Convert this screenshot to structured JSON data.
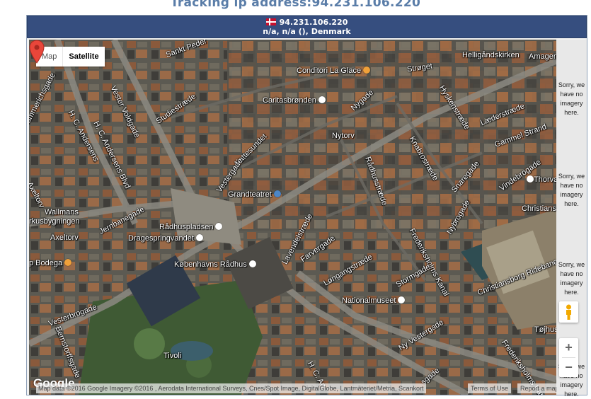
{
  "page": {
    "title": "Tracking ip address:94.231.106.220"
  },
  "header": {
    "ip": "94.231.106.220",
    "location": "n/a, n/a (), Denmark",
    "flag": "denmark-flag-icon"
  },
  "map": {
    "type_control": {
      "map_label": "Map",
      "satellite_label": "Satellite",
      "selected": "Satellite"
    },
    "labels": {
      "vester_voldgade": "Vester Voldgade",
      "sankt_peder": "Sankt Peder",
      "h_c_andersens_top": "H. C. Andersens",
      "hammerichsgade": "Hammerichsgade",
      "studiestraede": "Studiestræde",
      "conditori": "Conditori La Glace",
      "caritasbronden": "Caritasbrønden",
      "helligaandskirken": "Helligåndskirken",
      "amager": "Amager",
      "stroget": "Strøget",
      "hyskenstraede": "Hyskenstræde",
      "laederstraede": "Læderstræde",
      "nygade": "Nygade",
      "gammel_strand": "Gammel Strand",
      "h_c_andersens_blvd": "H. C. Andersens Blvd",
      "kattesundet": "Kattesundet",
      "nytorv": "Nytorv",
      "knabrostraede": "Knabrostræde",
      "snaregade": "Snaregade",
      "vestergade": "Vestergade",
      "radhusstraede": "Rådhusstræde",
      "vindebrogade": "Vindebrogade",
      "thorvald": "Thorval",
      "axeltorv_top": "Axeltorv",
      "grandteatret": "Grandteatret",
      "lavendelstraede": "Lavendelstræde",
      "nybrogade": "Nybrogade",
      "christiansborg": "Christians",
      "wallmans": "Wallmans",
      "rkusbygningen": "rkusbygningen",
      "jernbanegade": "Jernbanegade",
      "radhuspladsen": "Rådhuspladsen",
      "farvergade": "Farvergade",
      "frederiksholms_kanal": "Frederiksholms Kanal",
      "axeltorv": "Axeltorv",
      "dragespringvandet": "Dragespringvandet",
      "longangstraede": "Løngangstræde",
      "bodega": "p Bodega",
      "kobenhavns_radhus": "Københavns Rådhus",
      "christiansborg_ridebane": "Christiansborg Ridebane",
      "stormgade": "Stormgade",
      "vesterbrogade": "Vesterbrogade",
      "nationalmuseet": "Nationalmuseet",
      "bernstorffsgade": "Bernstorffsgade",
      "ny_vestergade": "Ny Vestergade",
      "tojhus": "Tøjhus",
      "frederiksholms_kanal_2": "Frederiksholms Kanal",
      "tivoli": "Tivoli",
      "h_c_an_bottom": "H. C. An",
      "sgade": "sgade"
    },
    "no_imagery": "Sorry, we have no imagery here.",
    "google_logo": "Google",
    "attribution": "Map data ©2016 Google Imagery ©2016 , Aerodata International Surveys, Cnes/Spot Image, DigitalGlobe, Lantmäteriet/Metria, Scankort",
    "terms": "Terms of Use",
    "report": "Report a map error",
    "zoom_in": "+",
    "zoom_out": "−"
  }
}
